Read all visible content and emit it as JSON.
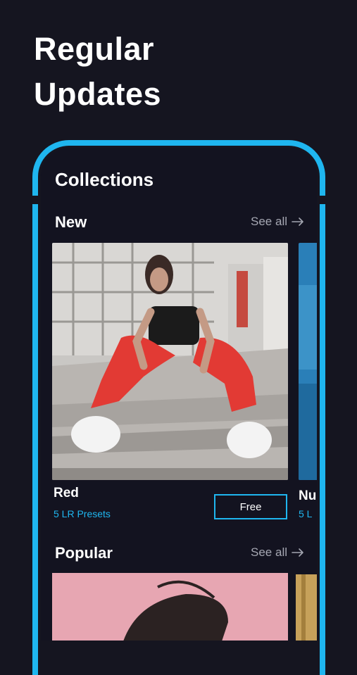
{
  "headline": {
    "line1": "Regular",
    "line2": "Updates"
  },
  "screen": {
    "title": "Collections",
    "sections": [
      {
        "title": "New",
        "see_all": "See all"
      },
      {
        "title": "Popular",
        "see_all": "See all"
      }
    ],
    "new_cards": [
      {
        "name": "Red",
        "subtitle": "5 LR Presets",
        "button": "Free"
      },
      {
        "name": "Nu",
        "subtitle": "5 L"
      }
    ]
  },
  "colors": {
    "accent": "#1fb6ef",
    "background": "#151520",
    "card_red": "#e23a34"
  }
}
